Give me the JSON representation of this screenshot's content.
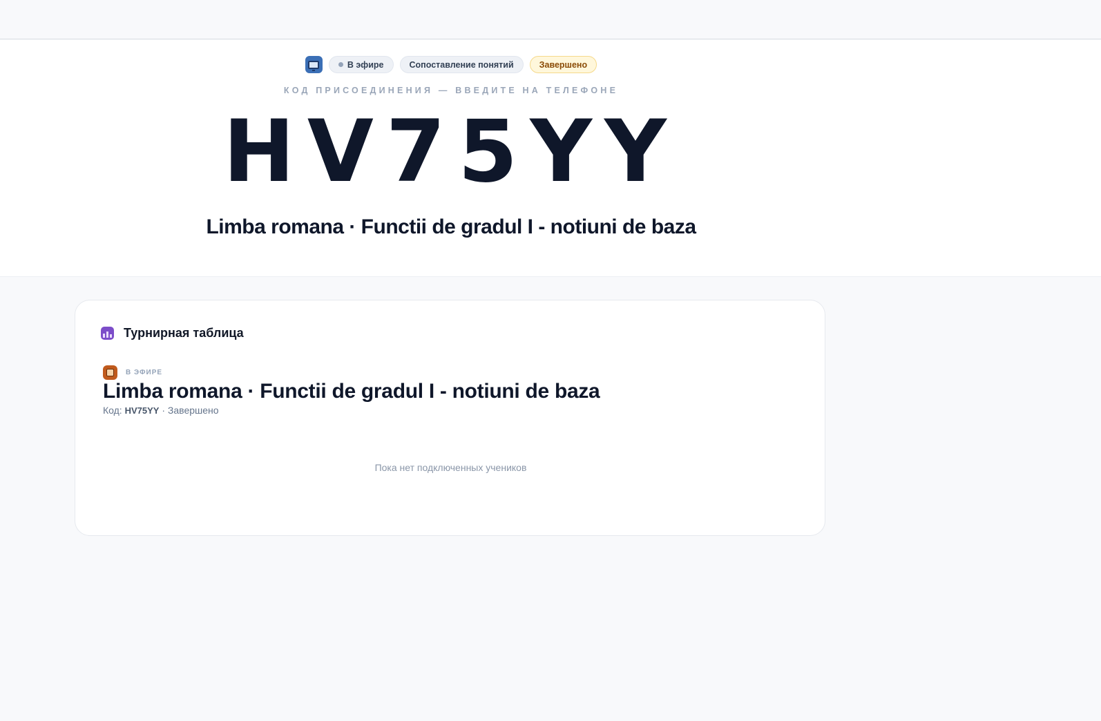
{
  "hero": {
    "badges": {
      "screen_icon": "monitor-icon",
      "live": "В эфире",
      "mode": "Сопоставление понятий",
      "status": "Завершено"
    },
    "join_label": "КОД ПРИСОЕДИНЕНИЯ — ВВЕДИТЕ НА ТЕЛЕФОНЕ",
    "code": "HV75YY",
    "title": "Limba romana · Functii de gradul I - notiuni de baza"
  },
  "leaderboard": {
    "icon": "trophy-icon",
    "title": "Турнирная таблица",
    "session": {
      "icon": "package-icon",
      "live_label": "В ЭФИРЕ",
      "title": "Limba romana · Functii de gradul I - notiuni de baza",
      "code_label": "Код:",
      "code": "HV75YY",
      "status": "Завершено"
    },
    "empty_message": "Пока нет подключенных учеников"
  },
  "colors": {
    "background": "#f8f9fb",
    "text": "#0f172a",
    "status_done_bg": "#fff7db",
    "status_done_text": "#8a4b06",
    "accent_purple": "#7c4dc9"
  }
}
